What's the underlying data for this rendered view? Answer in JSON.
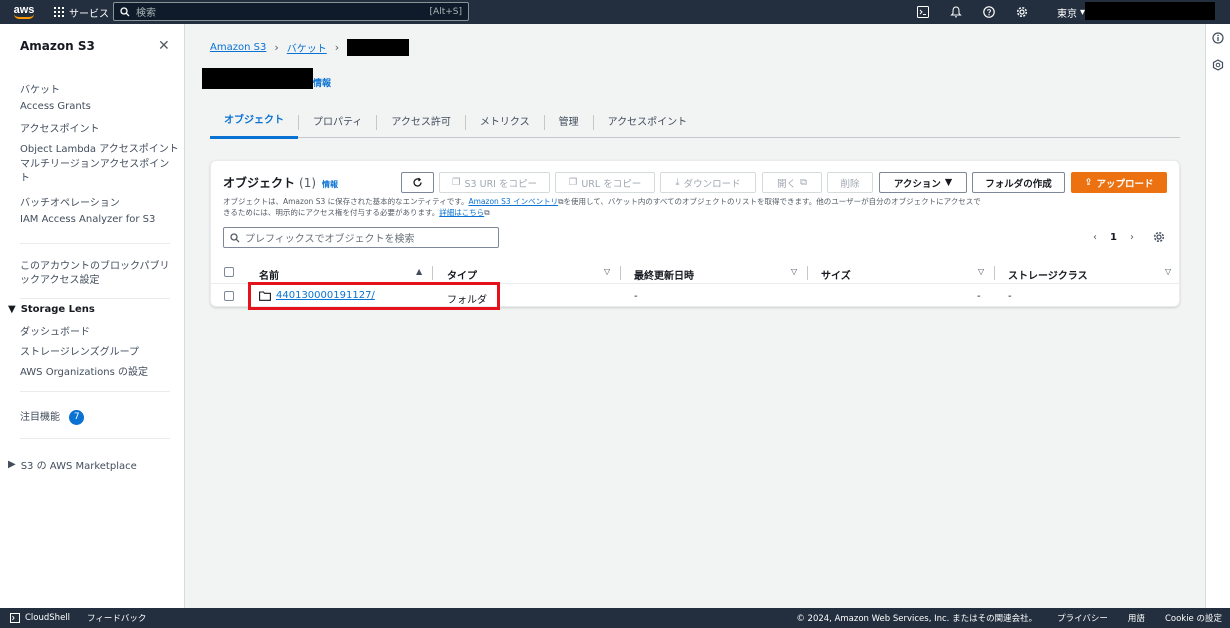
{
  "topnav": {
    "logo_text": "aws",
    "services_label": "サービス",
    "search_placeholder": "検索",
    "search_shortcut": "[Alt+S]",
    "region_label": "東京"
  },
  "sidebar": {
    "title": "Amazon S3",
    "items": [
      {
        "label": "バケット"
      },
      {
        "label": "Access Grants"
      },
      {
        "label": "アクセスポイント"
      },
      {
        "label": "Object Lambda アクセスポイント"
      },
      {
        "label": "マルチリージョンアクセスポイント"
      },
      {
        "label": "バッチオペレーション"
      },
      {
        "label": "IAM Access Analyzer for S3"
      }
    ],
    "block_public_label": "このアカウントのブロックパブリックアクセス設定",
    "storage_lens": {
      "title": "Storage Lens",
      "items": [
        {
          "label": "ダッシュボード"
        },
        {
          "label": "ストレージレンズグループ"
        },
        {
          "label": "AWS Organizations の設定"
        }
      ]
    },
    "featured_label": "注目機能",
    "featured_count": "7",
    "marketplace_label": "S3 の AWS Marketplace"
  },
  "breadcrumb": {
    "items": [
      "Amazon S3",
      "バケット"
    ]
  },
  "page": {
    "info_label": "情報"
  },
  "tabs": [
    {
      "label": "オブジェクト",
      "active": true
    },
    {
      "label": "プロパティ"
    },
    {
      "label": "アクセス許可"
    },
    {
      "label": "メトリクス"
    },
    {
      "label": "管理"
    },
    {
      "label": "アクセスポイント"
    }
  ],
  "objects": {
    "title": "オブジェクト",
    "count": "(1)",
    "info_label": "情報",
    "desc_1": "オブジェクトは、Amazon S3 に保存された基本的なエンティティです。",
    "desc_link_1": "Amazon S3 インベントリ",
    "desc_2": "を使用して、バケット内のすべてのオブジェクトのリストを取得できます。他のユーザーが自分のオブジェクトにアクセスできるためには、明示的にアクセス権を付与する必要があります。",
    "desc_link_2": "詳細はこちら",
    "buttons": {
      "copy_s3_uri": "S3 URI をコピー",
      "copy_url": "URL をコピー",
      "download": "ダウンロード",
      "open": "開く",
      "delete": "削除",
      "actions": "アクション",
      "create_folder": "フォルダの作成",
      "upload": "アップロード"
    },
    "filter_placeholder": "プレフィックスでオブジェクトを検索",
    "page_number": "1",
    "columns": [
      "名前",
      "タイプ",
      "最終更新日時",
      "サイズ",
      "ストレージクラス"
    ],
    "rows": [
      {
        "name": "440130000191127/",
        "type": "フォルダ",
        "modified": "-",
        "size": "-",
        "storage_class": "-"
      }
    ]
  },
  "footer": {
    "cloudshell": "CloudShell",
    "feedback": "フィードバック",
    "copyright": "© 2024, Amazon Web Services, Inc. またはその関連会社。",
    "privacy": "プライバシー",
    "terms": "用語",
    "cookie": "Cookie の設定"
  },
  "colors": {
    "nav_bg": "#232f3e",
    "accent": "#0972d3",
    "primary_button": "#ec7211",
    "highlight_box": "#e5121b"
  }
}
